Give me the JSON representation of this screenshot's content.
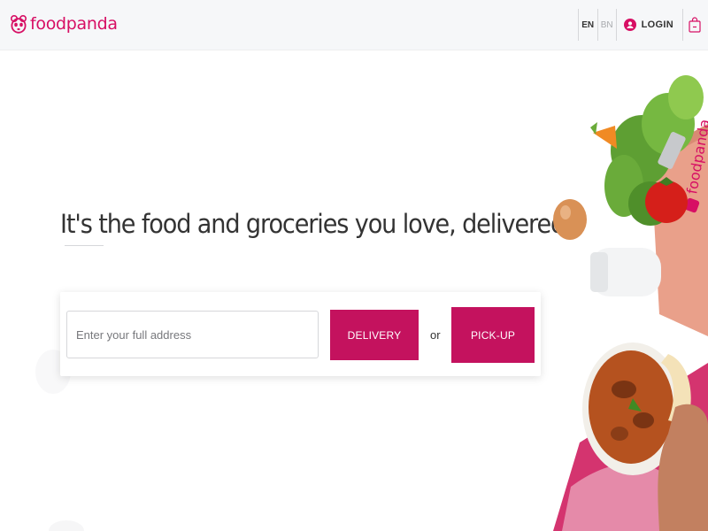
{
  "header": {
    "brand": "foodpanda",
    "languages": [
      {
        "code": "EN",
        "active": true
      },
      {
        "code": "BN",
        "active": false
      }
    ],
    "login_label": "LOGIN",
    "icons": {
      "logo": "panda-logo-icon",
      "user": "user-icon",
      "cart": "shopping-bag-icon"
    }
  },
  "hero": {
    "headline": "It's the food and groceries you love, delivered"
  },
  "search": {
    "address_placeholder": "Enter your full address",
    "delivery_label": "DELIVERY",
    "or_label": "or",
    "pickup_label": "PICK-UP"
  },
  "illustration": {
    "bag_text": "foodpanda"
  },
  "colors": {
    "brand": "#d70f64",
    "button": "#c4125e",
    "header_bg": "#f6f7f9"
  }
}
